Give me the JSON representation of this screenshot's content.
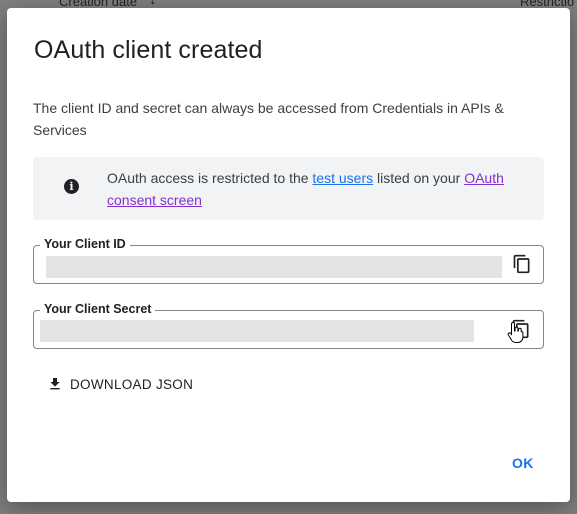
{
  "background_table": {
    "column_creation_date": "Creation date",
    "column_restrictions": "Restrictio"
  },
  "dialog": {
    "title": "OAuth client created",
    "description": "The client ID and secret can always be accessed from Credentials in APIs & Services",
    "info": {
      "text_before": "OAuth access is restricted to the ",
      "link_test_users": "test users",
      "text_middle": " listed on your ",
      "link_consent_screen": "OAuth consent screen",
      "icon": "info-icon"
    },
    "client_id": {
      "label": "Your Client ID",
      "value": ""
    },
    "client_secret": {
      "label": "Your Client Secret",
      "value": ""
    },
    "download_label": "DOWNLOAD JSON",
    "ok_label": "OK"
  },
  "colors": {
    "primary": "#1a73e8",
    "visited_link": "#8430ce",
    "scrim": "#7f7f7f",
    "info_bg": "#f1f3f4"
  }
}
